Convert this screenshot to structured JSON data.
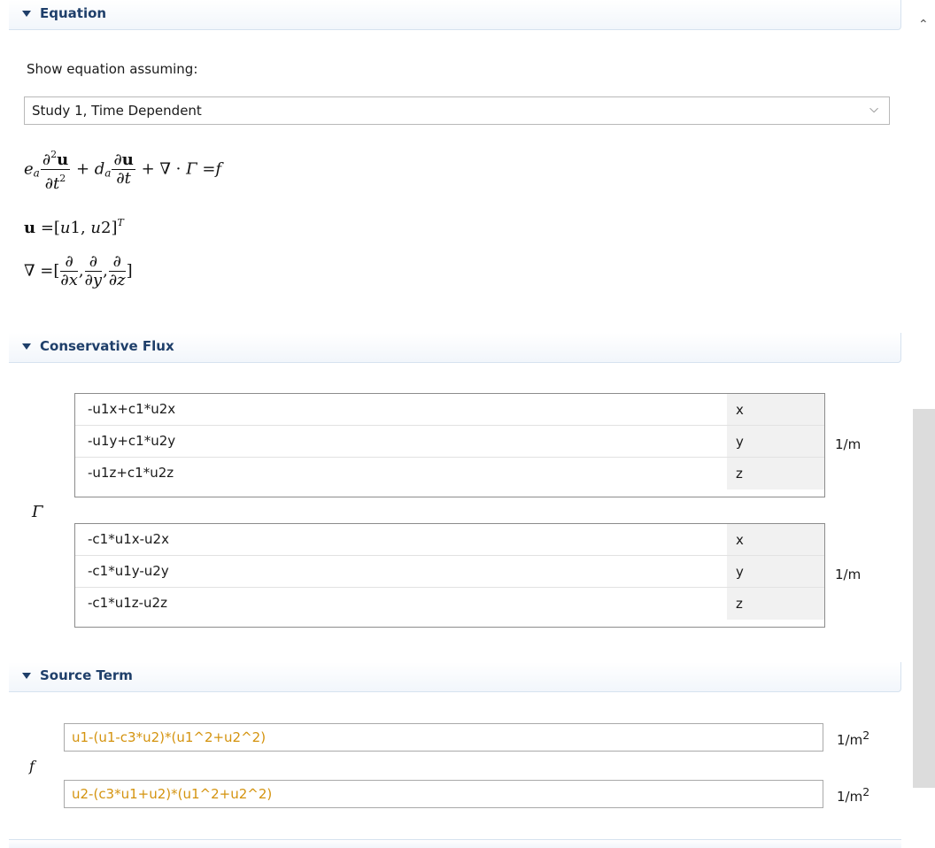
{
  "sections": {
    "equation": {
      "title": "Equation",
      "show_label": "Show equation assuming:",
      "study_select": "Study 1, Time Dependent"
    },
    "conservative_flux": {
      "title": "Conservative Flux",
      "symbol": "Γ",
      "vectors": [
        {
          "unit": "1/m",
          "rows": [
            {
              "expr": "-u1x+c1*u2x",
              "comp": "x"
            },
            {
              "expr": "-u1y+c1*u2y",
              "comp": "y"
            },
            {
              "expr": "-u1z+c1*u2z",
              "comp": "z"
            }
          ]
        },
        {
          "unit": "1/m",
          "rows": [
            {
              "expr": "-c1*u1x-u2x",
              "comp": "x"
            },
            {
              "expr": "-c1*u1y-u2y",
              "comp": "y"
            },
            {
              "expr": "-c1*u1z-u2z",
              "comp": "z"
            }
          ]
        }
      ]
    },
    "source_term": {
      "title": "Source Term",
      "symbol": "f",
      "fields": [
        {
          "expr": "u1-(u1-c3*u2)*(u1^2+u2^2)",
          "unit_base": "1/m",
          "unit_exp": "2"
        },
        {
          "expr": "u2-(c3*u1+u2)*(u1^2+u2^2)",
          "unit_base": "1/m",
          "unit_exp": "2"
        }
      ]
    }
  },
  "icons": {
    "collapse": "triangle-down-icon",
    "dropdown": "chevron-down-icon",
    "scroll_up": "chevron-up-icon"
  },
  "colors": {
    "header_text": "#1f3f6a",
    "expression_text": "#d4930e"
  }
}
